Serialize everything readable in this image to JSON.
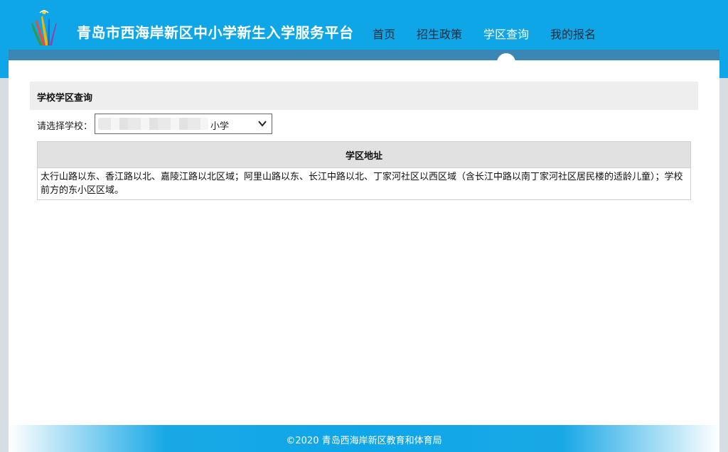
{
  "header": {
    "site_title": "青岛市西海岸新区中小学新生入学服务平台",
    "logo_icon": "colorful-brush-logo-icon"
  },
  "nav": {
    "items": [
      {
        "label": "首页",
        "active": false
      },
      {
        "label": "招生政策",
        "active": false
      },
      {
        "label": "学区查询",
        "active": true
      },
      {
        "label": "我的报名",
        "active": false
      }
    ]
  },
  "page": {
    "section_title": "学校学区查询",
    "select_label": "请选择学校：",
    "school_select": {
      "selected_value": "小学",
      "chevron_icon": "chevron-down-icon"
    },
    "table": {
      "header": "学区地址",
      "rows": [
        "太行山路以东、香江路以北、嘉陵江路以北区域；阿里山路以东、长江中路以北、丁家河社区以西区域（含长江中路以南丁家河社区居民楼的适龄儿童）；学校前方的东小区区域。"
      ]
    }
  },
  "footer": {
    "copyright": "©2020 青岛西海岸新区教育和体育局"
  },
  "colors": {
    "header_bg": "#0fa6e8",
    "header_band": "#3a86b4",
    "active_nav_text": "#ffffff",
    "nav_text": "#1b2b3a",
    "page_bg": "#d6dee3"
  }
}
